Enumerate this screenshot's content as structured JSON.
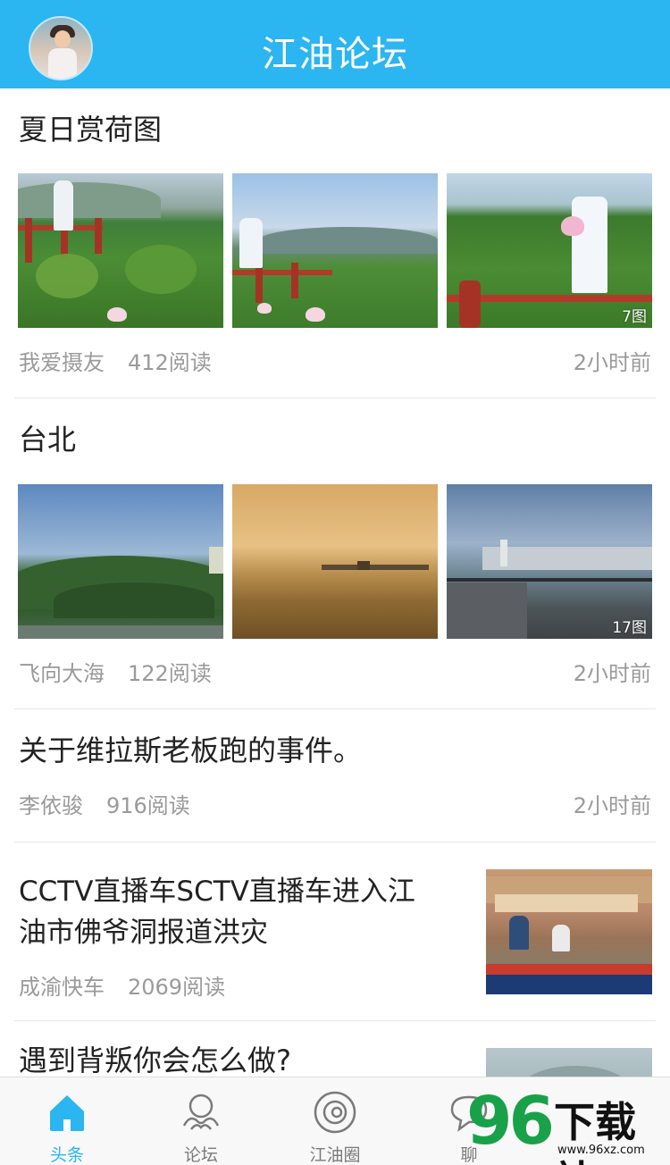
{
  "header": {
    "title": "江油论坛",
    "avatar_icon": "user-avatar"
  },
  "articles": [
    {
      "title": "夏日赏荷图",
      "author": "我爱摄友",
      "reads": "412阅读",
      "time": "2小时前",
      "image_count": "7图"
    },
    {
      "title": "台北",
      "author": "飞向大海",
      "reads": "122阅读",
      "time": "2小时前",
      "image_count": "17图"
    },
    {
      "title": "关于维拉斯老板跑的事件。",
      "author": "李依骏",
      "reads": "916阅读",
      "time": "2小时前"
    },
    {
      "title_line1": "CCTV直播车SCTV直播车进入江",
      "title_line2": "油市佛爷洞报道洪灾",
      "author": "成渝快车",
      "reads": "2069阅读"
    },
    {
      "title": "遇到背叛你会怎么做?"
    }
  ],
  "tabbar": {
    "tabs": [
      {
        "label": "头条",
        "icon": "home-icon",
        "active": true
      },
      {
        "label": "论坛",
        "icon": "forum-icon",
        "active": false
      },
      {
        "label": "江油圈",
        "icon": "circle-icon",
        "active": false
      },
      {
        "label": "聊",
        "icon": "chat-icon",
        "active": false
      }
    ]
  },
  "watermark": {
    "number": "96",
    "text": "下载站",
    "url": "www.96xz.com"
  },
  "colors": {
    "accent": "#2bb5f1",
    "meta_text": "#9a9a9a",
    "watermark_green": "#19a14a"
  }
}
